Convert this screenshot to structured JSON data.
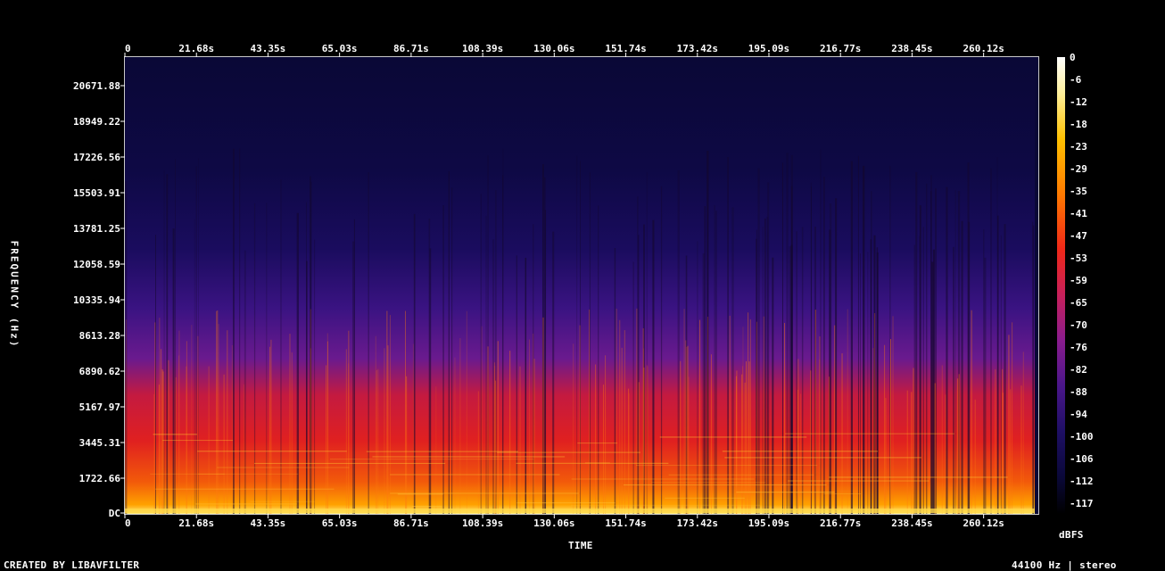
{
  "footer": {
    "left_text": "CREATED BY LIBAVFILTER",
    "right_text": "44100 Hz | stereo"
  },
  "chart_data": {
    "type": "heatmap",
    "title": "",
    "xlabel": "TIME",
    "ylabel": "FREQUENCY (Hz)",
    "colorbar_label": "dBFS",
    "x_tick_labels": [
      "0",
      "21.68s",
      "43.35s",
      "65.03s",
      "86.71s",
      "108.39s",
      "130.06s",
      "151.74s",
      "173.42s",
      "195.09s",
      "216.77s",
      "238.45s",
      "260.12s"
    ],
    "x_tick_values": [
      0,
      21.68,
      43.35,
      65.03,
      86.71,
      108.39,
      130.06,
      151.74,
      173.42,
      195.09,
      216.77,
      238.45,
      260.12
    ],
    "xlim": [
      0,
      276.7
    ],
    "y_tick_labels": [
      "DC",
      "1722.66",
      "3445.31",
      "5167.97",
      "6890.62",
      "8613.28",
      "10335.94",
      "12058.59",
      "13781.25",
      "15503.91",
      "17226.56",
      "18949.22",
      "20671.88"
    ],
    "y_tick_values": [
      0,
      1722.66,
      3445.31,
      5167.97,
      6890.62,
      8613.28,
      10335.94,
      12058.59,
      13781.25,
      15503.91,
      17226.56,
      18949.22,
      20671.88
    ],
    "ylim": [
      0,
      22050
    ],
    "colorbar_ticks": [
      "0",
      "-6",
      "-12",
      "-18",
      "-23",
      "-29",
      "-35",
      "-41",
      "-47",
      "-53",
      "-59",
      "-65",
      "-70",
      "-76",
      "-82",
      "-88",
      "-94",
      "-100",
      "-106",
      "-112",
      "-117"
    ],
    "colorbar_range": [
      -117,
      0
    ],
    "colormap": [
      "#000000",
      "#0a0530",
      "#1a0a5a",
      "#4a0f8a",
      "#8a1a8a",
      "#c4206a",
      "#ee2020",
      "#ff6a00",
      "#ffaa00",
      "#ffe040",
      "#ffffd0"
    ],
    "grid": false
  }
}
